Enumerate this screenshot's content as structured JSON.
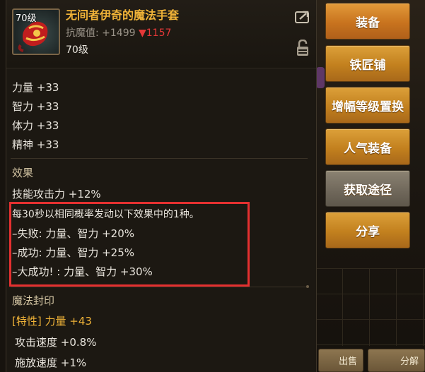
{
  "item": {
    "level_badge": "70级",
    "name": "无间者伊奇的魔法手套",
    "resist_label": "抗魔值: +1499",
    "resist_down_arrow": "▼",
    "resist_down_value": "1157",
    "level_text": "70级"
  },
  "base_stats": [
    "力量 +33",
    "智力 +33",
    "体力 +33",
    "精神 +33"
  ],
  "effect": {
    "title": "效果",
    "skill_attack": "技能攻击力 +12%",
    "proc_desc": "每30秒以相同概率发动以下效果中的1种。",
    "fail": "–失败: 力量、智力 +20%",
    "success": "–成功: 力量、智力 +25%",
    "great_success": "–大成功! : 力量、智力 +30%"
  },
  "magic_seal": {
    "title": "魔法封印",
    "trait_tag": "[特性]",
    "trait_value": " 力量 +43",
    "attack_speed": "攻击速度 +0.8%",
    "cast_speed": "施放速度 +1%"
  },
  "actions": {
    "equip": "装备",
    "blacksmith": "铁匠铺",
    "amplify_swap": "增幅等级置换",
    "popular_gear": "人气装备",
    "obtain_route": "获取途径",
    "share": "分享"
  },
  "bottom_actions": {
    "sell": "出售",
    "disassemble": "分解"
  },
  "colors": {
    "item_name": "#f0b338",
    "resist_down": "#e53838",
    "highlight_box": "#e53030",
    "button_gold": "#c2801e"
  },
  "icons": {
    "share": "share-arrow-icon",
    "lock": "padlock-icon",
    "item": "magic-glove-icon"
  }
}
